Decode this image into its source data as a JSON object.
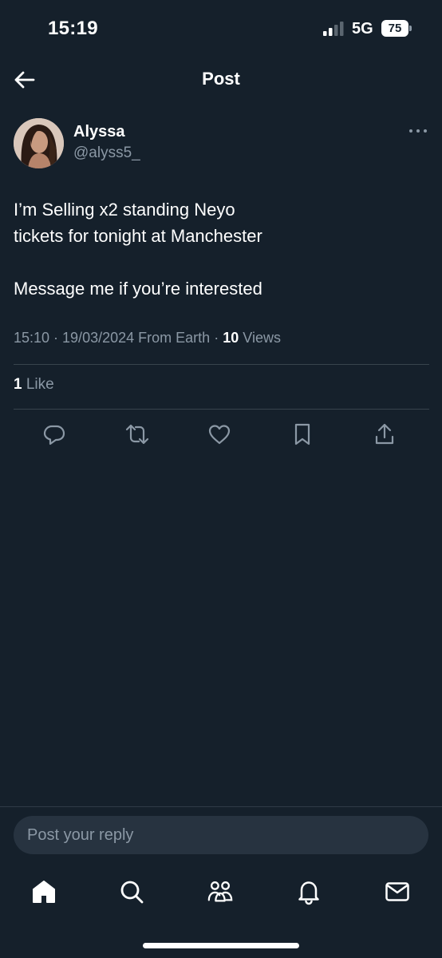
{
  "status_bar": {
    "time": "15:19",
    "network": "5G",
    "battery_percent": "75"
  },
  "header": {
    "title": "Post",
    "back_icon": "arrow-left-icon"
  },
  "post": {
    "author_name": "Alyssa",
    "author_handle": "@alyss5_",
    "text_lines": [
      "I’m Selling x2 standing Neyo",
      "tickets for tonight at Manchester",
      "",
      "Message me if you’re interested"
    ],
    "timestamp": "15:10 · 19/03/2024",
    "source": "From Earth",
    "views_count": "10",
    "views_label": "Views",
    "likes_count": "1",
    "likes_label": "Like"
  },
  "actions": [
    {
      "name": "reply",
      "icon": "comment-icon"
    },
    {
      "name": "repost",
      "icon": "repost-icon"
    },
    {
      "name": "like",
      "icon": "heart-icon"
    },
    {
      "name": "bookmark",
      "icon": "bookmark-icon"
    },
    {
      "name": "share",
      "icon": "share-icon"
    }
  ],
  "reply": {
    "placeholder": "Post your reply"
  },
  "bottom_nav": [
    {
      "name": "home",
      "icon": "home-icon",
      "active": true
    },
    {
      "name": "search",
      "icon": "search-icon",
      "active": false
    },
    {
      "name": "communities",
      "icon": "people-icon",
      "active": false
    },
    {
      "name": "notifications",
      "icon": "bell-icon",
      "active": false
    },
    {
      "name": "messages",
      "icon": "mail-icon",
      "active": false
    }
  ],
  "colors": {
    "background": "#15202b",
    "text_secondary": "#8b98a5",
    "divider": "#38444d",
    "input_bg": "#273340"
  }
}
